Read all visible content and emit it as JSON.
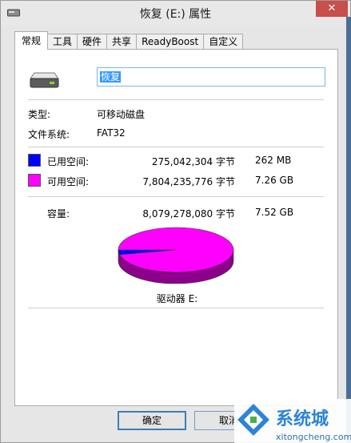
{
  "window": {
    "title": "恢复 (E:) 属性",
    "close_label": "✕"
  },
  "tabs": [
    {
      "label": "常规"
    },
    {
      "label": "工具"
    },
    {
      "label": "硬件"
    },
    {
      "label": "共享"
    },
    {
      "label": "ReadyBoost"
    },
    {
      "label": "自定义"
    }
  ],
  "general": {
    "name_value": "恢复",
    "type_label": "类型:",
    "type_value": "可移动磁盘",
    "fs_label": "文件系统:",
    "fs_value": "FAT32",
    "used": {
      "label": "已用空间:",
      "bytes": "275,042,304 字节",
      "size": "262 MB",
      "color": "#0000ff"
    },
    "free": {
      "label": "可用空间:",
      "bytes": "7,804,235,776 字节",
      "size": "7.26 GB",
      "color": "#ff00ff"
    },
    "capacity": {
      "label": "容量:",
      "bytes": "8,079,278,080 字节",
      "size": "7.52 GB"
    },
    "drive_label": "驱动器 E:"
  },
  "buttons": {
    "ok": "确定",
    "cancel": "取消"
  },
  "watermark": {
    "brand": "系统城",
    "url": "xitongcheng.com"
  },
  "chart_data": {
    "type": "pie",
    "categories": [
      "已用空间",
      "可用空间"
    ],
    "values": [
      275042304,
      7804235776
    ],
    "colors": [
      "#0000ff",
      "#ff00ff"
    ]
  }
}
